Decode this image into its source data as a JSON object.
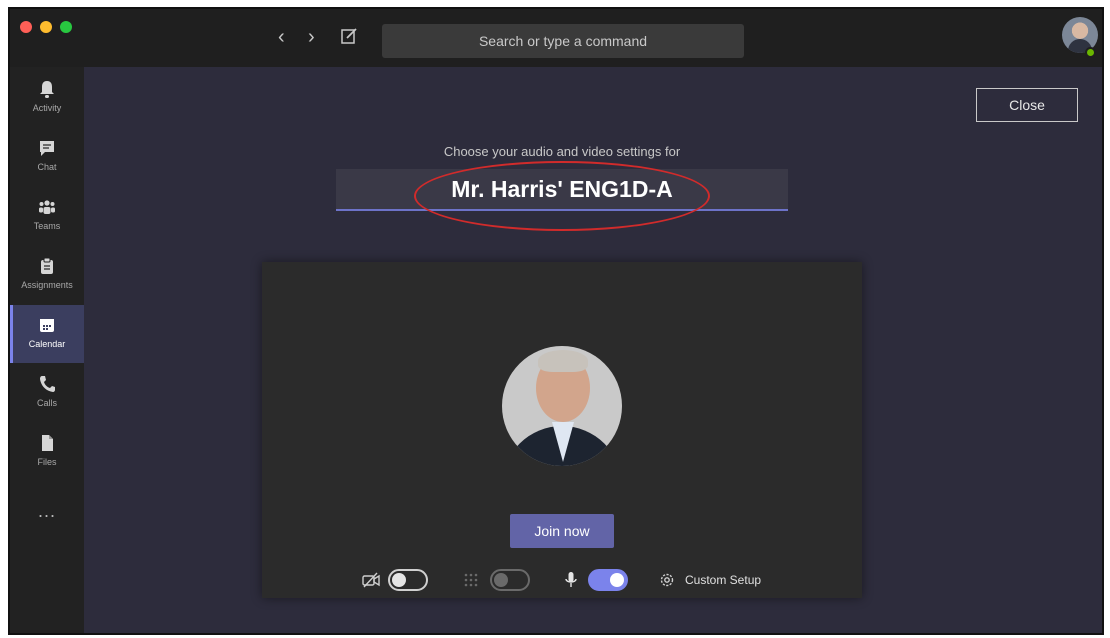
{
  "titlebar": {
    "search_placeholder": "Search or type a command"
  },
  "rail": {
    "items": [
      {
        "label": "Activity",
        "icon": "bell-icon"
      },
      {
        "label": "Chat",
        "icon": "chat-icon"
      },
      {
        "label": "Teams",
        "icon": "teams-icon"
      },
      {
        "label": "Assignments",
        "icon": "assignments-icon"
      },
      {
        "label": "Calendar",
        "icon": "calendar-icon",
        "active": true
      },
      {
        "label": "Calls",
        "icon": "phone-icon"
      },
      {
        "label": "Files",
        "icon": "file-icon"
      }
    ],
    "more": "..."
  },
  "main": {
    "close_label": "Close",
    "subtitle": "Choose your audio and video settings for",
    "meeting_name": "Mr. Harris' ENG1D-A",
    "join_label": "Join now",
    "custom_setup_label": "Custom Setup"
  },
  "controls": {
    "video_on": false,
    "blur_on": false,
    "mic_on": true
  },
  "colors": {
    "accent": "#6264a7",
    "toggle_on": "#7b83eb",
    "annotation": "#d12b2b",
    "background": "#2d2c3c"
  }
}
